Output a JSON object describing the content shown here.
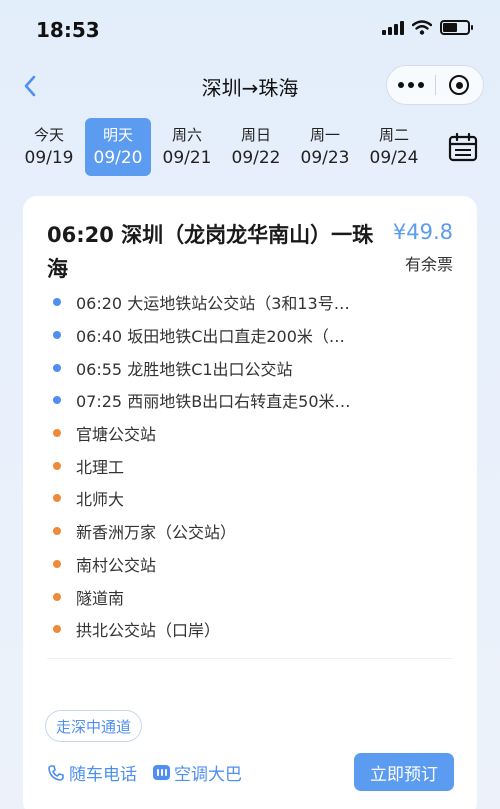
{
  "status": {
    "time": "18:53"
  },
  "nav": {
    "title": "深圳→珠海"
  },
  "dates": [
    {
      "weekday": "今天",
      "date": "09/19",
      "active": false
    },
    {
      "weekday": "明天",
      "date": "09/20",
      "active": true
    },
    {
      "weekday": "周六",
      "date": "09/21",
      "active": false
    },
    {
      "weekday": "周日",
      "date": "09/22",
      "active": false
    },
    {
      "weekday": "周一",
      "date": "09/23",
      "active": false
    },
    {
      "weekday": "周二",
      "date": "09/24",
      "active": false
    }
  ],
  "trip": {
    "title": "06:20 深圳（龙岗龙华南山）一珠海",
    "price": "¥49.8",
    "availability": "有余票",
    "stops": [
      {
        "text": "06:20 大运地铁站公交站（3和13号…",
        "type": "boarding"
      },
      {
        "text": "06:40 坂田地铁C出口直走200米（…",
        "type": "boarding"
      },
      {
        "text": "06:55 龙胜地铁C1出口公交站",
        "type": "boarding"
      },
      {
        "text": "07:25 西丽地铁B出口右转直走50米…",
        "type": "boarding"
      },
      {
        "text": "官塘公交站",
        "type": "alighting"
      },
      {
        "text": "北理工",
        "type": "alighting"
      },
      {
        "text": "北师大",
        "type": "alighting"
      },
      {
        "text": "新香洲万家（公交站）",
        "type": "alighting"
      },
      {
        "text": "南村公交站",
        "type": "alighting"
      },
      {
        "text": "隧道南",
        "type": "alighting"
      },
      {
        "text": "拱北公交站（口岸）",
        "type": "alighting"
      }
    ],
    "tag": "走深中通道",
    "features": {
      "phone": "随车电话",
      "ac": "空调大巴"
    },
    "book_label": "立即预订"
  },
  "colors": {
    "accent": "#5b9cf0",
    "boarding_dot": "#4f8ff0",
    "alighting_dot": "#ef8a3a"
  },
  "icons": [
    "back-arrow-icon",
    "more-dots-icon",
    "target-icon",
    "calendar-icon",
    "phone-icon",
    "ac-icon"
  ]
}
